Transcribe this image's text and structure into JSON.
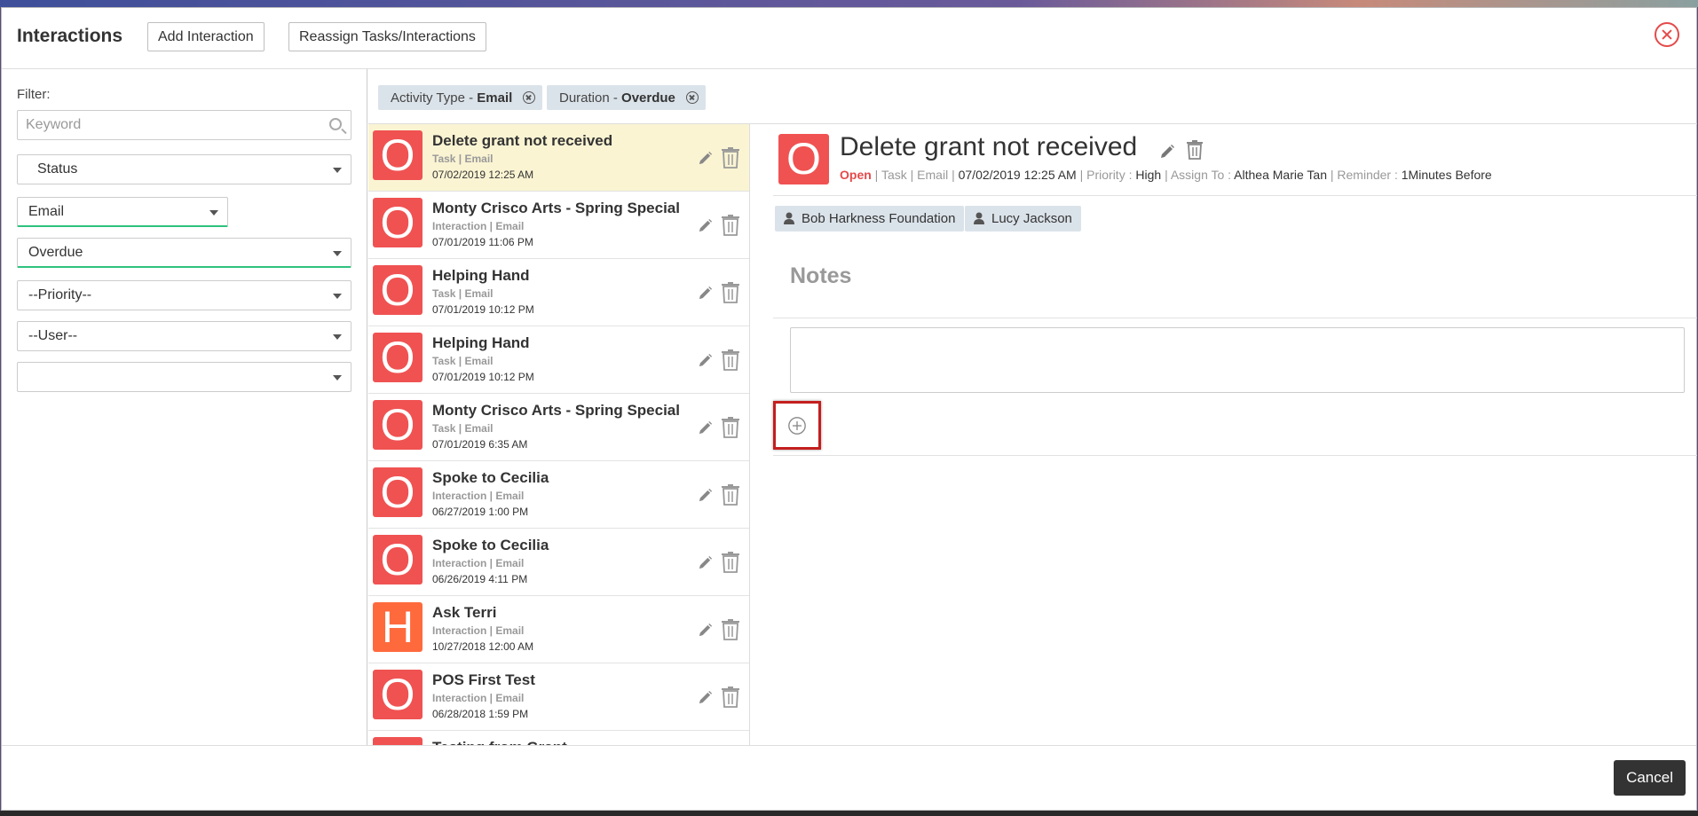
{
  "header": {
    "title": "Interactions",
    "add_button": "Add Interaction",
    "reassign_button": "Reassign Tasks/Interactions"
  },
  "filter": {
    "label": "Filter:",
    "keyword_placeholder": "Keyword",
    "status": "Status",
    "activity_type": "Email",
    "duration": "Overdue",
    "priority": "--Priority--",
    "user": "--User--",
    "extra": ""
  },
  "chips": [
    {
      "label": "Activity Type - ",
      "value": "Email"
    },
    {
      "label": "Duration - ",
      "value": "Overdue"
    }
  ],
  "list": [
    {
      "initial": "O",
      "color": "#f05252",
      "title": "Delete grant not received",
      "meta": "Task | Email",
      "date": "07/02/2019 12:25 AM",
      "selected": true
    },
    {
      "initial": "O",
      "color": "#f05252",
      "title": "Monty Crisco Arts - Spring Special",
      "meta": "Interaction | Email",
      "date": "07/01/2019 11:06 PM"
    },
    {
      "initial": "O",
      "color": "#f05252",
      "title": "Helping Hand",
      "meta": "Task | Email",
      "date": "07/01/2019 10:12 PM"
    },
    {
      "initial": "O",
      "color": "#f05252",
      "title": "Helping Hand",
      "meta": "Task | Email",
      "date": "07/01/2019 10:12 PM"
    },
    {
      "initial": "O",
      "color": "#f05252",
      "title": "Monty Crisco Arts - Spring Special",
      "meta": "Task | Email",
      "date": "07/01/2019 6:35 AM"
    },
    {
      "initial": "O",
      "color": "#f05252",
      "title": "Spoke to Cecilia",
      "meta": "Interaction | Email",
      "date": "06/27/2019 1:00 PM"
    },
    {
      "initial": "O",
      "color": "#f05252",
      "title": "Spoke to Cecilia",
      "meta": "Interaction | Email",
      "date": "06/26/2019 4:11 PM"
    },
    {
      "initial": "H",
      "color": "#ff6a3d",
      "title": "Ask Terri",
      "meta": "Interaction | Email",
      "date": "10/27/2018 12:00 AM"
    },
    {
      "initial": "O",
      "color": "#f05252",
      "title": "POS First Test",
      "meta": "Interaction | Email",
      "date": "06/28/2018 1:59 PM"
    },
    {
      "initial": "O",
      "color": "#f05252",
      "title": "Testing from Grant",
      "meta": "",
      "date": ""
    }
  ],
  "detail": {
    "initial": "O",
    "title": "Delete grant not received",
    "status": "Open",
    "type": "Task",
    "channel": "Email",
    "datetime": "07/02/2019 12:25 AM",
    "priority_label": "Priority : ",
    "priority": "High",
    "assign_label": "Assign To : ",
    "assign": "Althea Marie Tan",
    "reminder_label": "Reminder : ",
    "reminder": "1Minutes Before",
    "contacts": [
      "Bob Harkness Foundation",
      "Lucy Jackson"
    ],
    "notes_heading": "Notes"
  },
  "footer": {
    "cancel": "Cancel"
  }
}
